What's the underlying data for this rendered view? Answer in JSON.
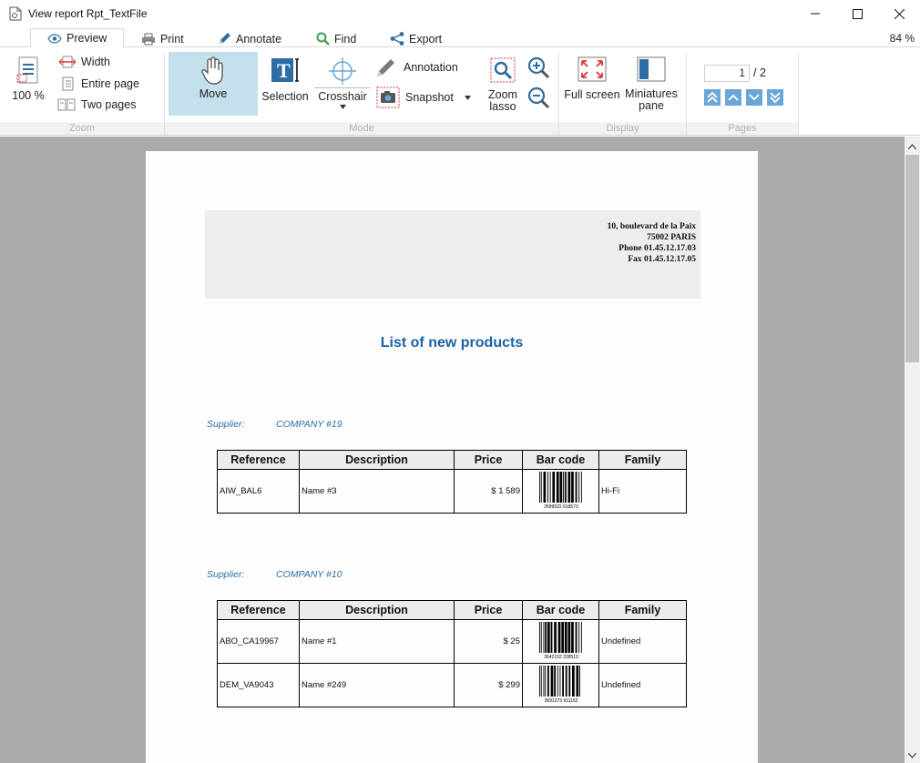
{
  "window": {
    "title": "View report Rpt_TextFile"
  },
  "tabs": [
    {
      "label": "Preview",
      "icon": "eye-icon"
    },
    {
      "label": "Print",
      "icon": "printer-icon"
    },
    {
      "label": "Annotate",
      "icon": "pencil-icon"
    },
    {
      "label": "Find",
      "icon": "magnifier-icon"
    },
    {
      "label": "Export",
      "icon": "share-icon"
    }
  ],
  "zoom_level": "84 %",
  "ribbon": {
    "zoom": {
      "hundred": "100 %",
      "width": "Width",
      "entire_page": "Entire page",
      "two_pages": "Two pages",
      "group_label": "Zoom"
    },
    "mode": {
      "move": "Move",
      "selection": "Selection",
      "crosshair": "Crosshair",
      "annotation": "Annotation",
      "snapshot": "Snapshot",
      "zoom_lasso_1": "Zoom",
      "zoom_lasso_2": "lasso",
      "group_label": "Mode"
    },
    "display": {
      "full_screen": "Full screen",
      "miniatures_1": "Miniatures",
      "miniatures_2": "pane",
      "group_label": "Display"
    },
    "pages": {
      "current": "1",
      "total": "/ 2",
      "group_label": "Pages"
    }
  },
  "report": {
    "address": [
      "10, boulevard de la Paix",
      "75002 PARIS",
      "Phone 01.45.12.17.03",
      "Fax 01.45.12.17.05"
    ],
    "title": "List of new products",
    "supplier_label": "Supplier:",
    "columns": [
      "Reference",
      "Description",
      "Price",
      "Bar code",
      "Family"
    ],
    "groups": [
      {
        "supplier": "COMPANY #19",
        "rows": [
          {
            "reference": "AIW_BAL6",
            "description": "Name #3",
            "price": "$ 1 589",
            "barcode": "3599522 618573",
            "family": "Hi-Fi"
          }
        ]
      },
      {
        "supplier": "COMPANY #10",
        "rows": [
          {
            "reference": "ABO_CA19967",
            "description": "Name #1",
            "price": "$ 25",
            "barcode": "3642152 228519",
            "family": "Undefined"
          },
          {
            "reference": "DEM_VA9043",
            "description": "Name #249",
            "price": "$ 299",
            "barcode": "3691273 911152",
            "family": "Undefined"
          }
        ]
      }
    ]
  }
}
